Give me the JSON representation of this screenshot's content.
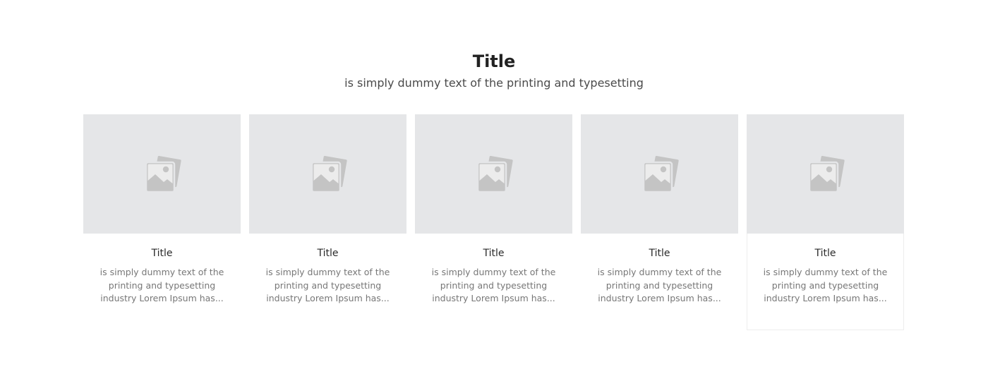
{
  "header": {
    "title": "Title",
    "subtitle": "is simply dummy text of the printing and typesetting"
  },
  "cards": [
    {
      "image_icon": "image-placeholder-icon",
      "title": "Title",
      "description": "is simply dummy text of the printing and typesetting industry Lorem Ipsum has..."
    },
    {
      "image_icon": "image-placeholder-icon",
      "title": "Title",
      "description": "is simply dummy text of the printing and typesetting industry Lorem Ipsum has..."
    },
    {
      "image_icon": "image-placeholder-icon",
      "title": "Title",
      "description": "is simply dummy text of the printing and typesetting industry Lorem Ipsum has..."
    },
    {
      "image_icon": "image-placeholder-icon",
      "title": "Title",
      "description": "is simply dummy text of the printing and typesetting industry Lorem Ipsum has..."
    },
    {
      "image_icon": "image-placeholder-icon",
      "title": "Title",
      "description": "is simply dummy text of the printing and typesetting industry Lorem Ipsum has..."
    }
  ],
  "colors": {
    "image_placeholder_bg": "#e5e6e8",
    "icon": "#c4c4c4",
    "title_text": "#222222",
    "body_text": "#777777"
  }
}
